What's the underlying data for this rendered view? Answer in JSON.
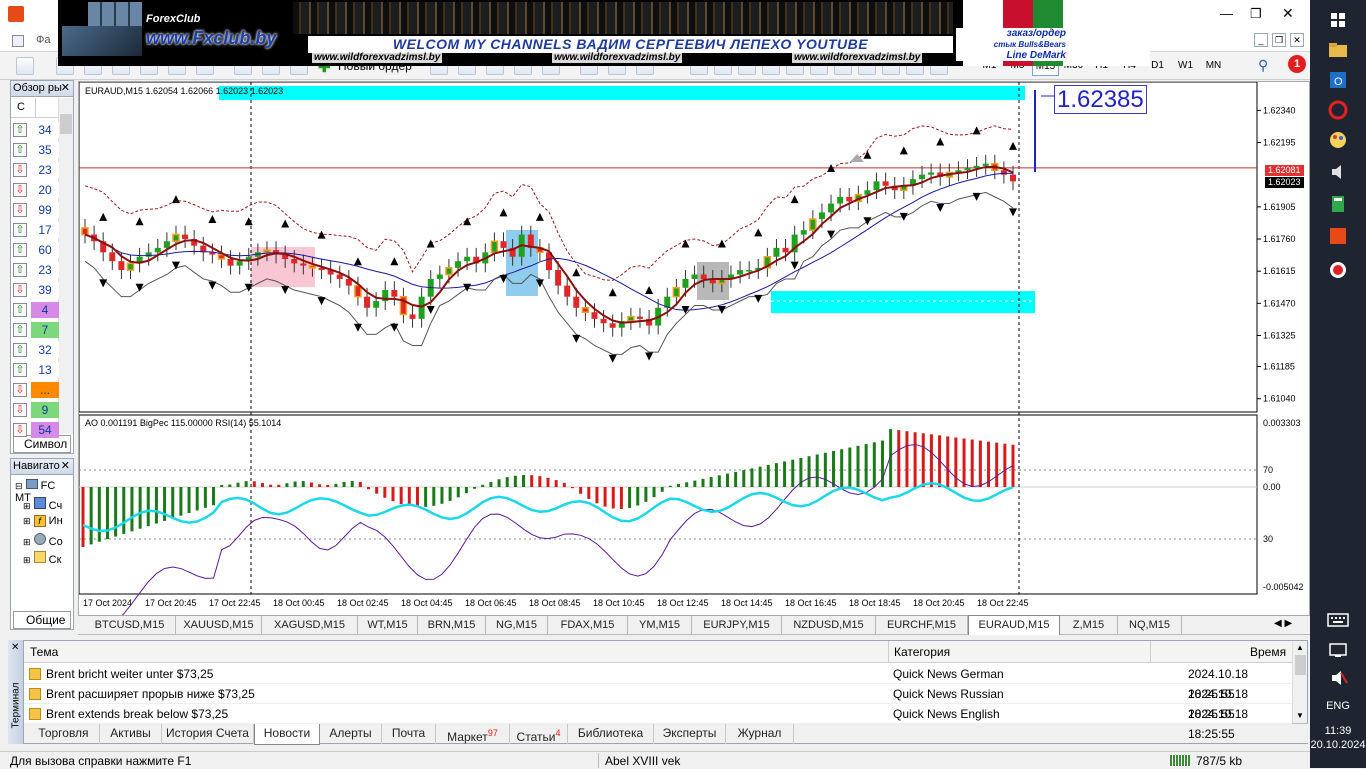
{
  "window": {
    "menu_partial": "Фа"
  },
  "banner": {
    "logo_text": "ForexClub",
    "site": "www.Fxclub.by",
    "welcome": "WELCOM MY CHANNELS ВАДИМ СЕРГЕЕВИЧ ЛЕПЕХО YOUTUBE",
    "urls": [
      "www.wildforexvadzimsl.by",
      "www.wildforexvadzimsl.by",
      "www.wildforexvadzimsl.by"
    ],
    "right_lines": [
      "заказ/ордер",
      "стык Bulls&Bears",
      "Line DeMark"
    ]
  },
  "toolbar": {
    "new_order": "Новый ордер",
    "timeframes": [
      "M1",
      "M5",
      "M15",
      "M30",
      "H1",
      "H4",
      "D1",
      "W1",
      "MN"
    ],
    "active_timeframe": "M15",
    "notification_count": "1"
  },
  "market_watch": {
    "title": "Обзор ры",
    "header_partial": "C",
    "rows": [
      {
        "dir": "up",
        "value": "34",
        "color": "#ffffff"
      },
      {
        "dir": "up",
        "value": "35",
        "color": "#ffffff"
      },
      {
        "dir": "dn",
        "value": "23",
        "color": "#ffffff"
      },
      {
        "dir": "dn",
        "value": "20",
        "color": "#ffffff"
      },
      {
        "dir": "dn",
        "value": "99",
        "color": "#ffffff"
      },
      {
        "dir": "up",
        "value": "17",
        "color": "#ffffff"
      },
      {
        "dir": "up",
        "value": "60",
        "color": "#ffffff"
      },
      {
        "dir": "up",
        "value": "23",
        "color": "#ffffff"
      },
      {
        "dir": "dn",
        "value": "39",
        "color": "#ffffff"
      },
      {
        "dir": "up",
        "value": "4",
        "color": "#d58ae6"
      },
      {
        "dir": "up",
        "value": "7",
        "color": "#7dd87d"
      },
      {
        "dir": "up",
        "value": "32",
        "color": "#ffffff"
      },
      {
        "dir": "up",
        "value": "13",
        "color": "#ffffff"
      },
      {
        "dir": "dn",
        "value": "...",
        "color": "#ff8a00"
      },
      {
        "dir": "dn",
        "value": "9",
        "color": "#7dd87d"
      },
      {
        "dir": "dn",
        "value": "54",
        "color": "#d58ae6"
      }
    ],
    "tab": "Символ"
  },
  "navigator": {
    "title": "Навигато",
    "items": [
      "FC MT",
      "Сч",
      "Ин",
      "Со",
      "Ск"
    ],
    "tab": "Общие"
  },
  "chart": {
    "header": "EURAUD,M15  1.62054 1.62066 1.62023 1.62023",
    "sub_header": "AO 0.001191  BigPec 115.00000  RSI(14) 55.1014",
    "big_price": "1.62385",
    "bid_label": "1.62081",
    "ask_label": "1.62023",
    "bid_color": "#e03030",
    "ask_color": "#000000"
  },
  "chart_data": {
    "type": "candlestick",
    "symbol": "EURAUD",
    "timeframe": "M15",
    "price_ticks": [
      "1.62340",
      "1.62195",
      "1.61905",
      "1.61760",
      "1.61615",
      "1.61470",
      "1.61325",
      "1.61185",
      "1.61040"
    ],
    "price_tick_values": [
      1.6234,
      1.62195,
      1.61905,
      1.6176,
      1.61615,
      1.6147,
      1.61325,
      1.61185,
      1.6104
    ],
    "indicator_ticks": [
      "0.003303",
      "70",
      "0.00",
      "30",
      "-0.005042"
    ],
    "x_ticks": [
      "17 Oct 2024",
      "17 Oct 20:45",
      "17 Oct 22:45",
      "18 Oct 00:45",
      "18 Oct 02:45",
      "18 Oct 04:45",
      "18 Oct 06:45",
      "18 Oct 08:45",
      "18 Oct 10:45",
      "18 Oct 12:45",
      "18 Oct 14:45",
      "18 Oct 16:45",
      "18 Oct 18:45",
      "18 Oct 20:45",
      "18 Oct 22:45"
    ],
    "close": [
      1.6178,
      1.6175,
      1.617,
      1.6166,
      1.6162,
      1.6165,
      1.6168,
      1.617,
      1.6172,
      1.6175,
      1.6178,
      1.6176,
      1.6173,
      1.617,
      1.6169,
      1.6167,
      1.6164,
      1.6166,
      1.6168,
      1.617,
      1.6171,
      1.6169,
      1.6167,
      1.6165,
      1.6164,
      1.6163,
      1.6162,
      1.616,
      1.6158,
      1.6155,
      1.615,
      1.6145,
      1.6148,
      1.6153,
      1.615,
      1.6142,
      1.614,
      1.615,
      1.6158,
      1.616,
      1.6163,
      1.6166,
      1.6168,
      1.6165,
      1.617,
      1.6175,
      1.6172,
      1.6168,
      1.6178,
      1.6172,
      1.617,
      1.6162,
      1.6155,
      1.615,
      1.6145,
      1.6143,
      1.614,
      1.6138,
      1.6136,
      1.6139,
      1.6141,
      1.614,
      1.6137,
      1.6145,
      1.615,
      1.6154,
      1.6158,
      1.616,
      1.6158,
      1.6156,
      1.6158,
      1.616,
      1.6162,
      1.6162,
      1.6163,
      1.6168,
      1.6172,
      1.617,
      1.6178,
      1.618,
      1.6185,
      1.6188,
      1.6192,
      1.6195,
      1.6193,
      1.6196,
      1.6198,
      1.6202,
      1.62,
      1.6198,
      1.62,
      1.6203,
      1.6205,
      1.6206,
      1.6204,
      1.6206,
      1.6207,
      1.6208,
      1.6209,
      1.621,
      1.6207,
      1.6205,
      1.6202
    ],
    "resistance_band_price": 1.6238,
    "support_band_price": 1.6148,
    "current_price": 1.62023
  },
  "symbol_tabs": [
    "BTCUSD,M15",
    "XAUUSD,M15",
    "XAGUSD,M15",
    "WT,M15",
    "BRN,M15",
    "NG,M15",
    "FDAX,M15",
    "YM,M15",
    "EURJPY,M15",
    "NZDUSD,M15",
    "EURCHF,M15",
    "EURAUD,M15",
    "Z,M15",
    "NQ,M15"
  ],
  "active_symbol_tab": "EURAUD,M15",
  "terminal": {
    "side_label": "Терминал",
    "columns": [
      "Тема",
      "Категория",
      "Время"
    ],
    "rows": [
      {
        "topic": "Brent bricht weiter unter $73,25",
        "category": "Quick News German",
        "time": "2024.10.18 18:25:55"
      },
      {
        "topic": "Brent расширяет прорыв ниже $73,25",
        "category": "Quick News Russian",
        "time": "2024.10.18 18:25:55"
      },
      {
        "topic": "Brent extends break below $73,25",
        "category": "Quick News English",
        "time": "2024.10.18 18:25:55"
      }
    ],
    "tabs": [
      {
        "label": "Торговля",
        "badge": ""
      },
      {
        "label": "Активы",
        "badge": ""
      },
      {
        "label": "История Счета",
        "badge": ""
      },
      {
        "label": "Новости",
        "badge": ""
      },
      {
        "label": "Алерты",
        "badge": ""
      },
      {
        "label": "Почта",
        "badge": ""
      },
      {
        "label": "Маркет",
        "badge": "97"
      },
      {
        "label": "Статьи",
        "badge": "4"
      },
      {
        "label": "Библиотека",
        "badge": ""
      },
      {
        "label": "Эксперты",
        "badge": ""
      },
      {
        "label": "Журнал",
        "badge": ""
      }
    ],
    "active_tab": "Новости"
  },
  "status": {
    "help": "Для вызова справки нажмите F1",
    "profile": "Abel XVIII vek",
    "traffic": "787/5 kb"
  },
  "taskbar": {
    "lang": "ENG",
    "time": "11:39",
    "date": "20.10.2024"
  }
}
